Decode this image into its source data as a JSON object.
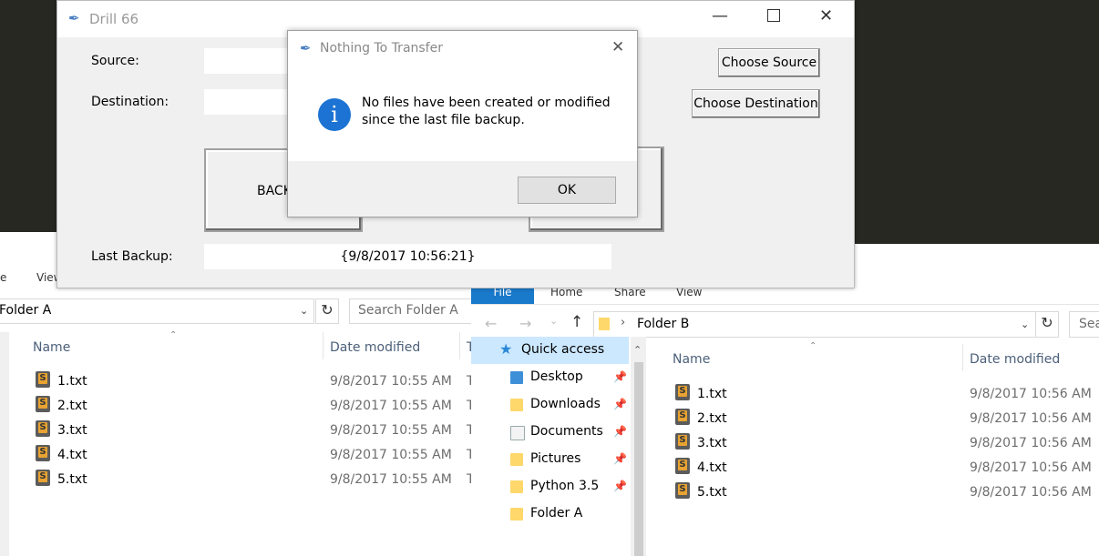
{
  "explorer_a": {
    "menu_partial": "e",
    "menu_view": "View",
    "address": "Folder A",
    "search_placeholder": "Search Folder A",
    "col_name": "Name",
    "col_date": "Date modified",
    "col_type_partial": "T",
    "files": [
      {
        "name": "1.txt",
        "date": "9/8/2017 10:55 AM",
        "type": "T"
      },
      {
        "name": "2.txt",
        "date": "9/8/2017 10:55 AM",
        "type": "T"
      },
      {
        "name": "3.txt",
        "date": "9/8/2017 10:55 AM",
        "type": "T"
      },
      {
        "name": "4.txt",
        "date": "9/8/2017 10:55 AM",
        "type": "T"
      },
      {
        "name": "5.txt",
        "date": "9/8/2017 10:55 AM",
        "type": "T"
      }
    ]
  },
  "explorer_b": {
    "tabs": [
      "File",
      "Home",
      "Share",
      "View"
    ],
    "address": "Folder B",
    "search_placeholder": "Sea",
    "col_name": "Name",
    "col_date": "Date modified",
    "nav": [
      {
        "label": "Quick access",
        "pinned": false
      },
      {
        "label": "Desktop",
        "pinned": true
      },
      {
        "label": "Downloads",
        "pinned": true
      },
      {
        "label": "Documents",
        "pinned": true
      },
      {
        "label": "Pictures",
        "pinned": true
      },
      {
        "label": "Python 3.5",
        "pinned": true
      },
      {
        "label": "Folder A",
        "pinned": false
      }
    ],
    "files": [
      {
        "name": "1.txt",
        "date": "9/8/2017 10:56 AM"
      },
      {
        "name": "2.txt",
        "date": "9/8/2017 10:56 AM"
      },
      {
        "name": "3.txt",
        "date": "9/8/2017 10:56 AM"
      },
      {
        "name": "4.txt",
        "date": "9/8/2017 10:56 AM"
      },
      {
        "name": "5.txt",
        "date": "9/8/2017 10:56 AM"
      }
    ]
  },
  "tk_window": {
    "title": "Drill 66",
    "source_label": "Source:",
    "destination_label": "Destination:",
    "choose_source": "Choose Source",
    "choose_destination": "Choose Destination",
    "backup_button_partial": "BACK",
    "last_backup_label": "Last Backup:",
    "last_backup_value": "{9/8/2017  10:56:21}"
  },
  "dialog": {
    "title": "Nothing To Transfer",
    "message_line1": "No files have been created or modified",
    "message_line2": "since the last file backup.",
    "ok": "OK",
    "icon": "info-icon",
    "accent": "#1c73d3"
  }
}
